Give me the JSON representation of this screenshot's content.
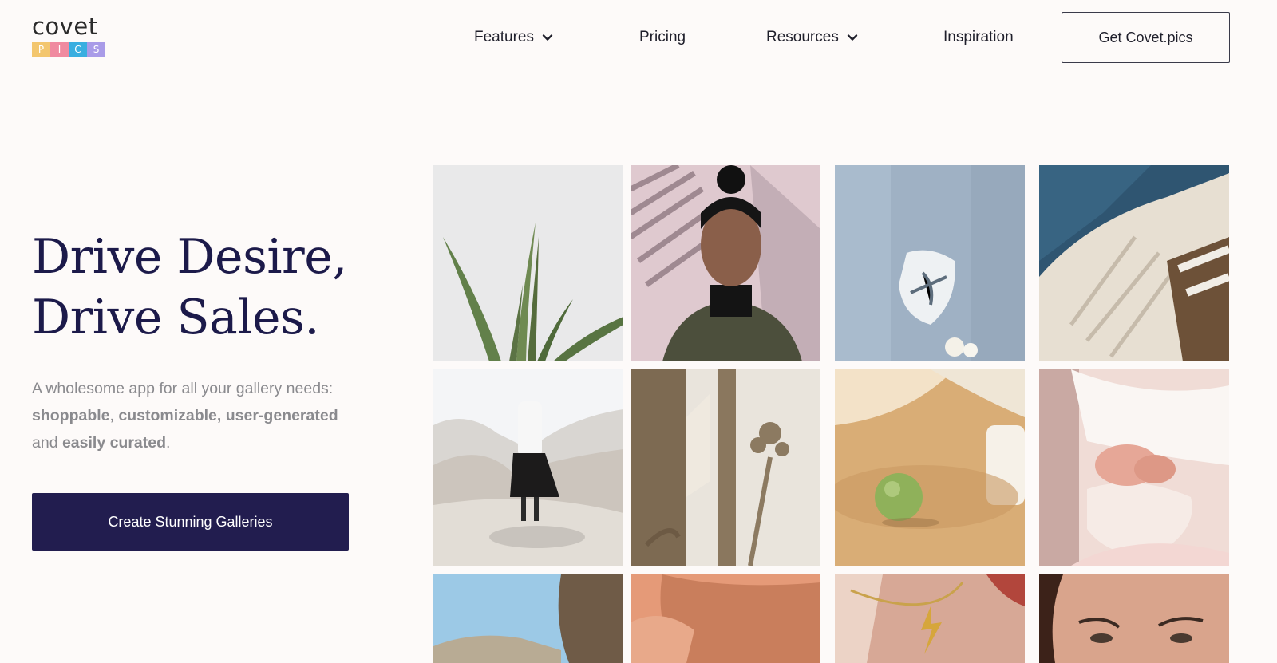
{
  "logo": {
    "word": "covet",
    "tiles": [
      {
        "letter": "P",
        "color": "#f3c66e"
      },
      {
        "letter": "I",
        "color": "#f08aa0"
      },
      {
        "letter": "C",
        "color": "#3aaee0"
      },
      {
        "letter": "S",
        "color": "#a99be8"
      }
    ]
  },
  "nav": {
    "features": "Features",
    "pricing": "Pricing",
    "resources": "Resources",
    "inspiration": "Inspiration",
    "cta": "Get Covet.pics"
  },
  "hero": {
    "title_line1": "Drive Desire,",
    "title_line2": "Drive Sales.",
    "desc": {
      "p1": "A wholesome app for all your gallery needs: ",
      "b1": "shoppable",
      "p2": ", ",
      "b2": "customizable, user-generated",
      "p3": " and ",
      "b3": "easily curated",
      "p4": "."
    },
    "cta": "Create Stunning Galleries"
  },
  "colors": {
    "brand_navy": "#221d4f",
    "background": "#fdfaf9",
    "title": "#1c1a4a"
  },
  "gallery": [
    "plant-leaves-photo",
    "woman-turtleneck-photo",
    "window-shadow-photo",
    "pool-chair-photo",
    "woman-beach-walk-photo",
    "flower-shadow-photo",
    "green-apple-photo",
    "knit-sweater-hands-photo",
    "beach-sky-photo",
    "arm-skin-photo",
    "necklace-photo",
    "woman-face-photo"
  ]
}
